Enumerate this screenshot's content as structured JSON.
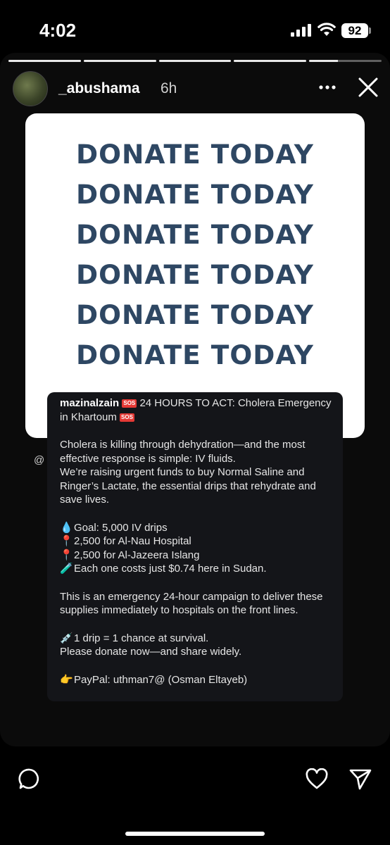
{
  "status_bar": {
    "time": "4:02",
    "battery": "92"
  },
  "story": {
    "progress_segments": [
      1,
      1,
      1,
      1,
      0.4
    ],
    "username": "_abushama",
    "time_ago": "6h",
    "card_lines": [
      "DONATE TODAY",
      "DONATE TODAY",
      "DONATE TODAY",
      "DONATE TODAY",
      "DONATE TODAY",
      "DONATE TODAY"
    ],
    "card_text_color": "#2e4763",
    "mention": "@",
    "caption": {
      "username": "mazinalzain",
      "sos_badge": "SOS",
      "headline": "24 HOURS TO ACT: Cholera Emergency in Khartoum",
      "para1": "Cholera is killing through dehydration—and the most effective response is simple: IV fluids.",
      "para2": "We’re raising urgent funds to buy Normal Saline and Ringer’s Lactate, the essential drips that rehydrate and save lives.",
      "items": [
        {
          "icon": "💧",
          "text": "Goal: 5,000 IV drips"
        },
        {
          "icon": "📍",
          "text": "2,500 for Al-Nau Hospital"
        },
        {
          "icon": "📍",
          "text": "2,500 for Al-Jazeera Islang"
        },
        {
          "icon": "🧪",
          "text": "Each one costs just $0.74 here in Sudan."
        }
      ],
      "para3": "This is an emergency 24-hour campaign to deliver these supplies immediately to hospitals on the front lines.",
      "syringe_icon": "💉",
      "line_drip": "1 drip = 1 chance at survival.",
      "line_donate": "Please donate now—and share widely.",
      "pointer_icon": "👉",
      "paypal": "PayPal: uthman7@ (Osman Eltayeb)"
    }
  }
}
